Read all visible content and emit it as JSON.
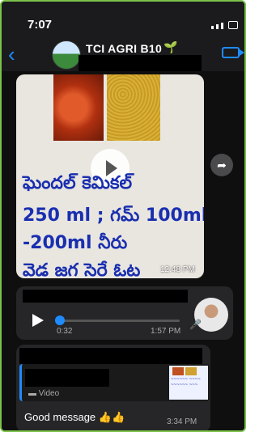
{
  "status_bar": {
    "time": "7:07"
  },
  "header": {
    "title": "TCI AGRI B10",
    "back_icon": "chevron-left-icon",
    "call_icon": "video-call-icon"
  },
  "messages": {
    "video": {
      "handwriting": [
        "ఘెందల్ కెమికల్",
        "250 ml ; గమ్ 100ml",
        "-200ml నీరు",
        "వెడ జగ సెరే ఓట"
      ],
      "time": "12:48 PM"
    },
    "voice": {
      "duration": "0:32",
      "time": "1:57 PM"
    },
    "forwarded": {
      "quote_label": "Video",
      "caption": "Good message 👍👍",
      "time": "3:34 PM"
    }
  },
  "colors": {
    "accent": "#1e8bff",
    "border": "#7bc24a",
    "handwriting": "#1a2fb0"
  }
}
